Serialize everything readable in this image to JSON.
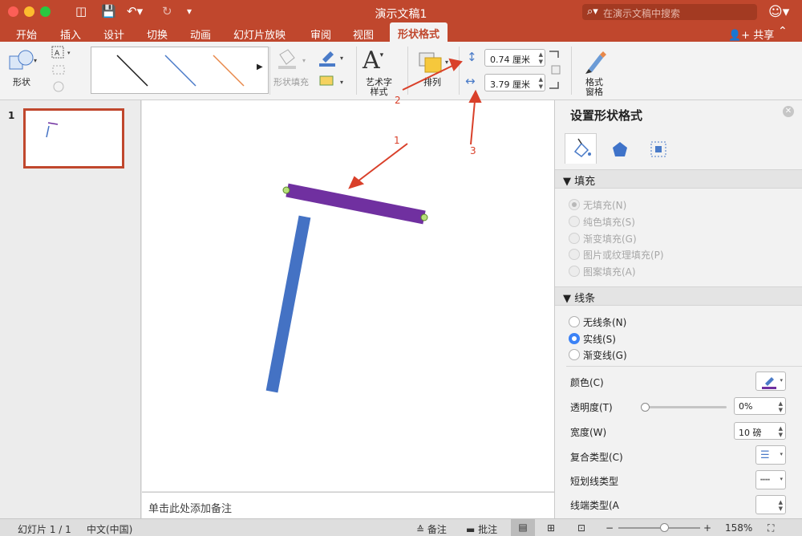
{
  "window": {
    "title": "演示文稿1",
    "search_placeholder": "在演示文稿中搜索"
  },
  "tabs": [
    {
      "label": "开始"
    },
    {
      "label": "插入"
    },
    {
      "label": "设计"
    },
    {
      "label": "切换"
    },
    {
      "label": "动画"
    },
    {
      "label": "幻灯片放映"
    },
    {
      "label": "审阅"
    },
    {
      "label": "视图"
    },
    {
      "label": "形状格式",
      "active": true
    }
  ],
  "share_label": "共享",
  "ribbon": {
    "shape_label": "形状",
    "shape_fill_label": "形状填充",
    "wordart_label": "艺术字\n样式",
    "arrange_label": "排列",
    "format_pane_label": "格式\n窗格",
    "height_value": "0.74 厘米",
    "width_value": "3.79 厘米",
    "line_styles": [
      {
        "color": "#1a1a1a"
      },
      {
        "color": "#4a7bc8"
      },
      {
        "color": "#e8884a"
      }
    ]
  },
  "slides_pane": {
    "slide_number": "1"
  },
  "canvas": {
    "notes_placeholder": "单击此处添加备注",
    "annotations": [
      "1",
      "2",
      "3"
    ],
    "purple_line_color": "#7030a0",
    "blue_line_color": "#4472c4"
  },
  "format_pane": {
    "title": "设置形状格式",
    "fill_section": "填充",
    "fill_options": [
      {
        "label": "无填充(N)",
        "selected": true
      },
      {
        "label": "纯色填充(S)",
        "selected": false
      },
      {
        "label": "渐变填充(G)",
        "selected": false
      },
      {
        "label": "图片或纹理填充(P)",
        "selected": false
      },
      {
        "label": "图案填充(A)",
        "selected": false
      }
    ],
    "line_section": "线条",
    "line_options": [
      {
        "label": "无线条(N)",
        "selected": false
      },
      {
        "label": "实线(S)",
        "selected": true
      },
      {
        "label": "渐变线(G)",
        "selected": false
      }
    ],
    "color_label": "颜色(C)",
    "color_value": "#7030a0",
    "transparency_label": "透明度(T)",
    "transparency_value": "0%",
    "width_label": "宽度(W)",
    "width_value": "10 磅",
    "compound_label": "复合类型(C)",
    "dash_label": "短划线类型",
    "cap_label": "线端类型(A"
  },
  "status": {
    "slide_info": "幻灯片 1 / 1",
    "language": "中文(中国)",
    "notes_label": "备注",
    "comments_label": "批注",
    "zoom": "158%"
  }
}
